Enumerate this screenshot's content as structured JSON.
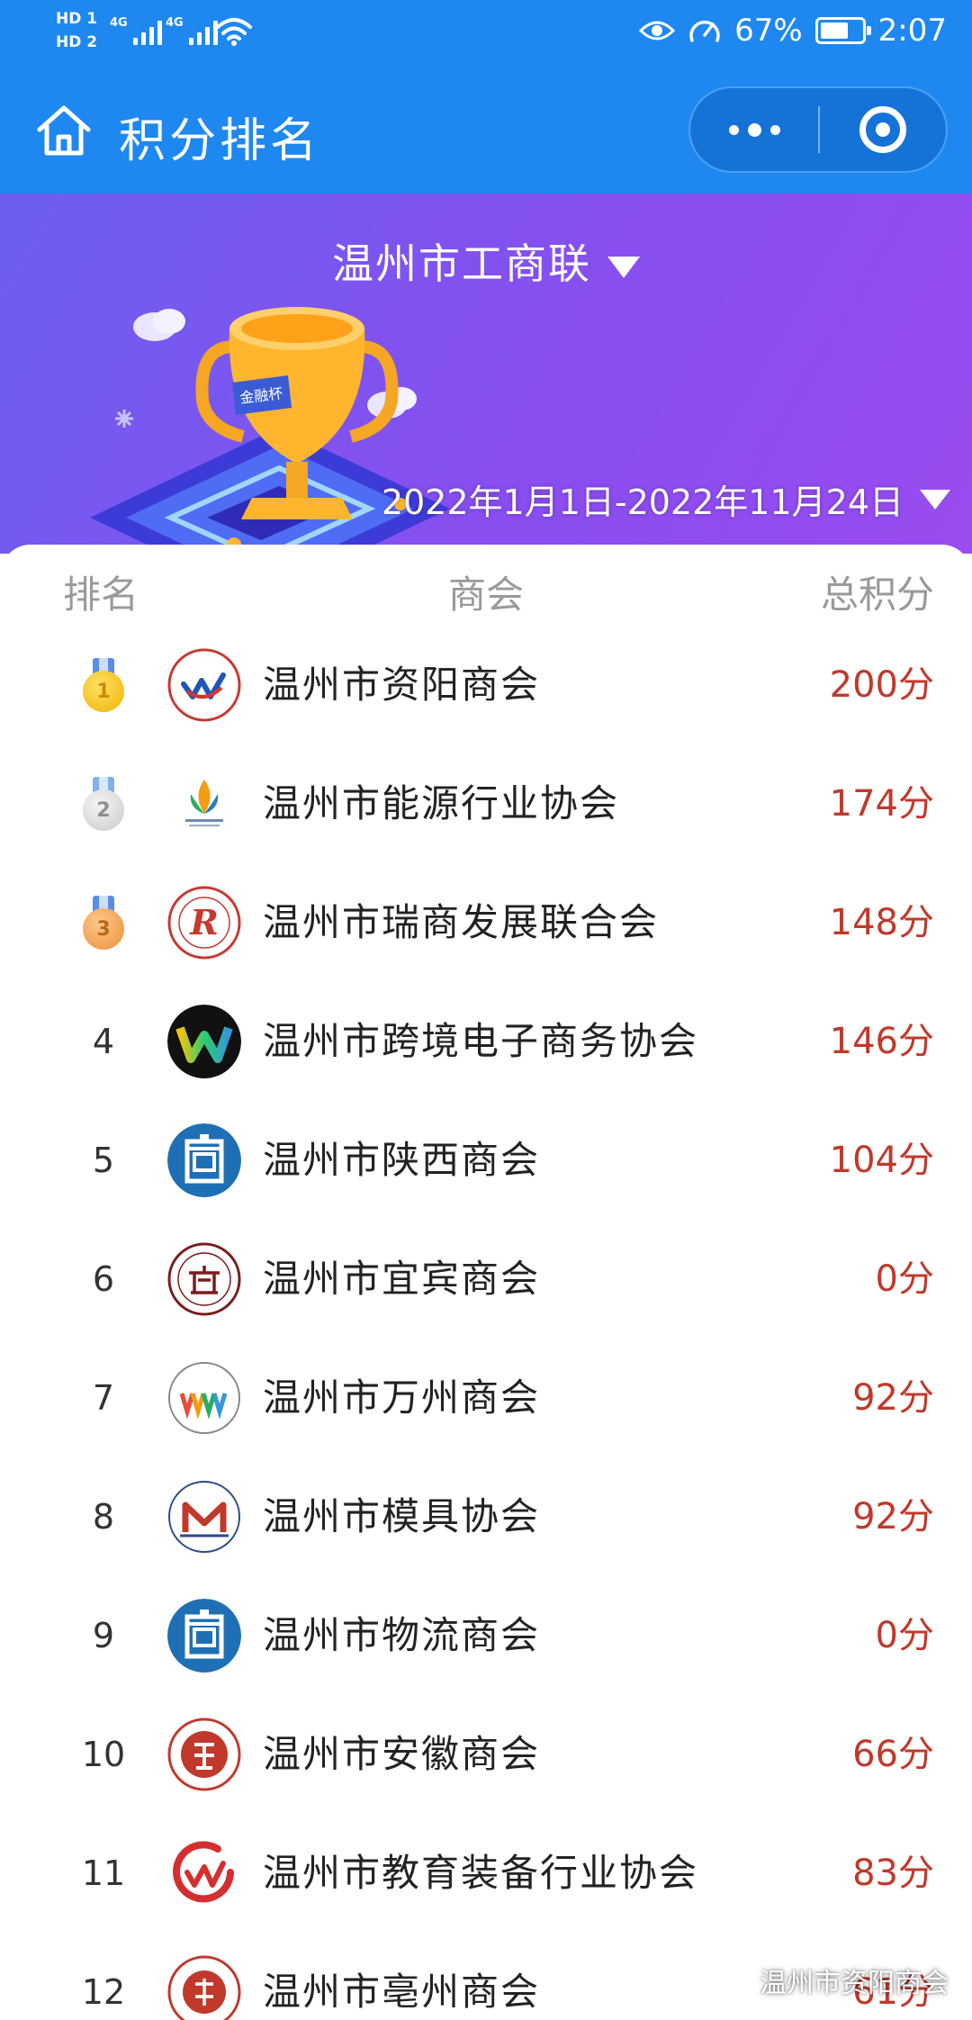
{
  "status_bar": {
    "hd1": "HD 1",
    "hd2": "HD 2",
    "net1": "4G",
    "net2": "4G",
    "battery_percent": "67%",
    "time": "2:07"
  },
  "header": {
    "title": "积分排名",
    "home_icon": "home-icon",
    "more_icon": "more-dots-icon",
    "close_icon": "close-target-icon",
    "color": "#1e88f0"
  },
  "banner": {
    "org": "温州市工商联",
    "trophy_label": "金融杯",
    "date_range": "2022年1月1日-2022年11月24日"
  },
  "table": {
    "col_rank": "排名",
    "col_org": "商会",
    "col_score": "总积分",
    "rows": [
      {
        "rank": "1",
        "name": "温州市资阳商会",
        "score": "200分",
        "medal": "gold"
      },
      {
        "rank": "2",
        "name": "温州市能源行业协会",
        "score": "174分",
        "medal": "silver"
      },
      {
        "rank": "3",
        "name": "温州市瑞商发展联合会",
        "score": "148分",
        "medal": "bronze"
      },
      {
        "rank": "4",
        "name": "温州市跨境电子商务协会",
        "score": "146分"
      },
      {
        "rank": "5",
        "name": "温州市陕西商会",
        "score": "104分"
      },
      {
        "rank": "6",
        "name": "温州市宜宾商会",
        "score": "0分"
      },
      {
        "rank": "7",
        "name": "温州市万州商会",
        "score": "92分"
      },
      {
        "rank": "8",
        "name": "温州市模具协会",
        "score": "92分"
      },
      {
        "rank": "9",
        "name": "温州市物流商会",
        "score": "0分"
      },
      {
        "rank": "10",
        "name": "温州市安徽商会",
        "score": "66分"
      },
      {
        "rank": "11",
        "name": "温州市教育装备行业协会",
        "score": "83分"
      },
      {
        "rank": "12",
        "name": "温州市亳州商会",
        "score": "61分"
      }
    ]
  },
  "watermark": "温州市资阳商会",
  "colors": {
    "score": "#c0392b",
    "banner_start": "#6c5ff0",
    "banner_end": "#9a4cf0"
  }
}
